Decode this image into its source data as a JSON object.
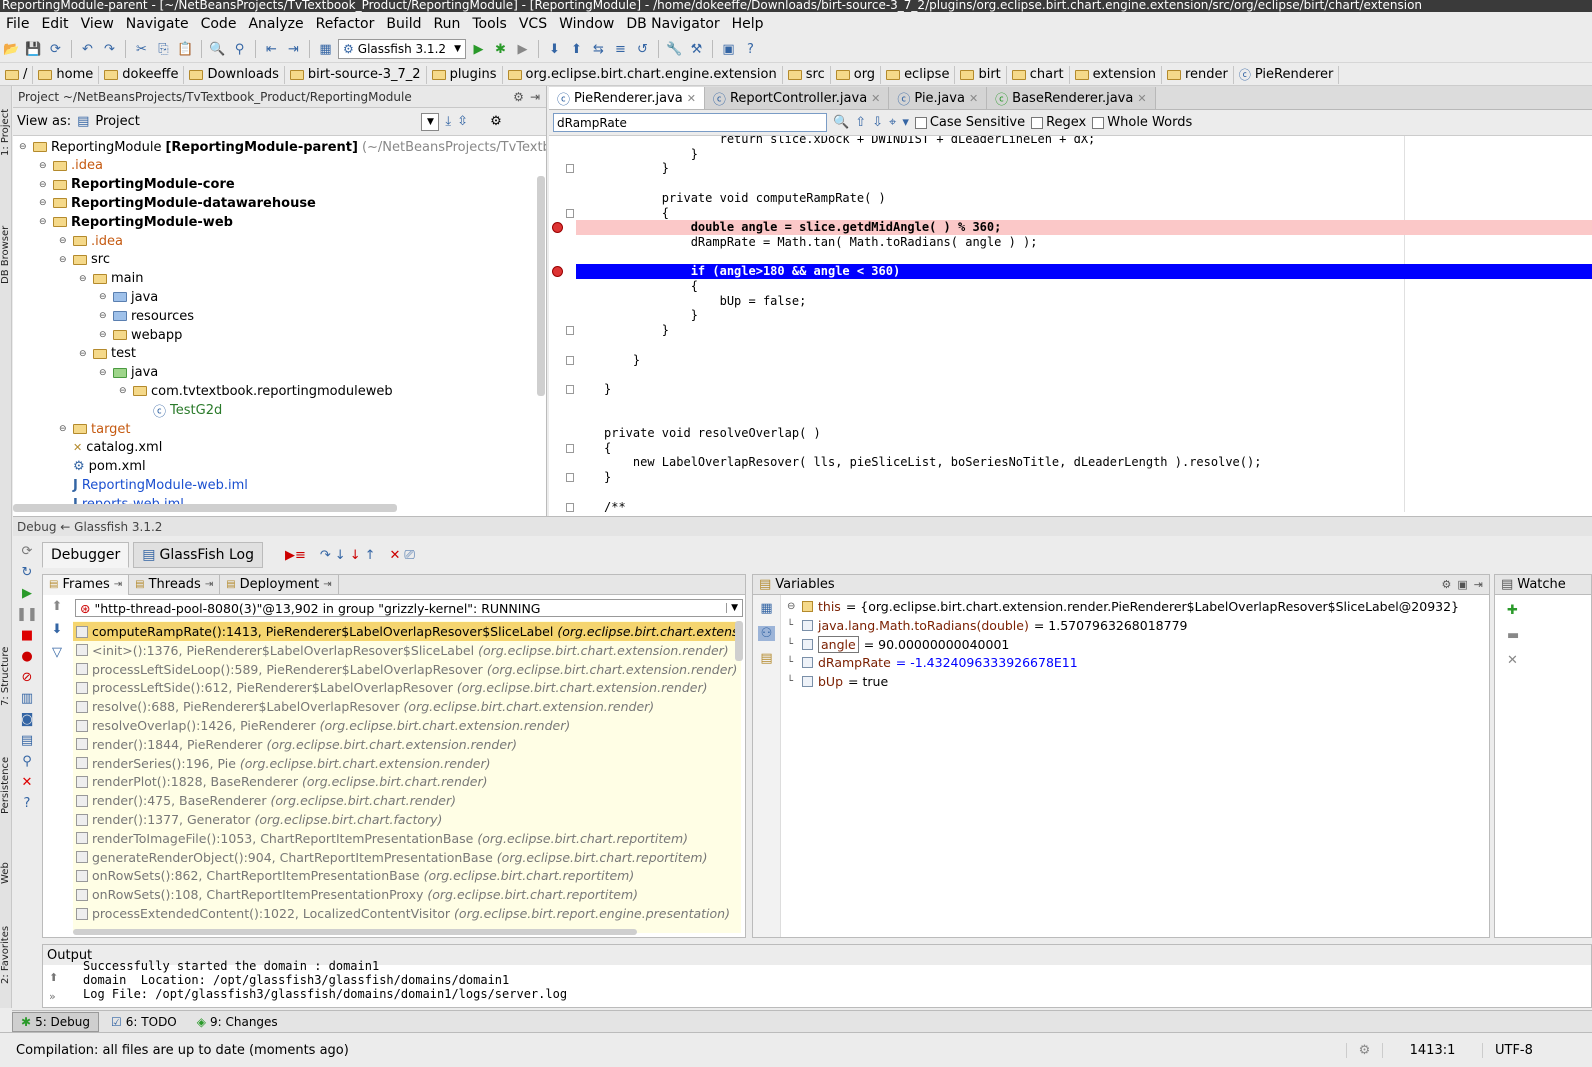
{
  "window": {
    "title": "ReportingModule-parent - [~/NetBeansProjects/TvTextbook_Product/ReportingModule] - [ReportingModule] - /home/dokeeffe/Downloads/birt-source-3_7_2/plugins/org.eclipse.birt.chart.engine.extension/src/org/eclipse/birt/chart/extension"
  },
  "menu": [
    "File",
    "Edit",
    "View",
    "Navigate",
    "Code",
    "Analyze",
    "Refactor",
    "Build",
    "Run",
    "Tools",
    "VCS",
    "Window",
    "DB Navigator",
    "Help"
  ],
  "toolbar": {
    "run_config": "Glassfish 3.1.2"
  },
  "breadcrumbs": [
    "/",
    "home",
    "dokeeffe",
    "Downloads",
    "birt-source-3_7_2",
    "plugins",
    "org.eclipse.birt.chart.engine.extension",
    "src",
    "org",
    "eclipse",
    "birt",
    "chart",
    "extension",
    "render",
    "PieRenderer"
  ],
  "left_strip": {
    "project": "1: Project",
    "db_browser": "DB Browser",
    "structure": "7: Structure",
    "persistence": "Persistence",
    "web": "Web",
    "favorites": "2: Favorites"
  },
  "project": {
    "header": "Project  ~/NetBeansProjects/TvTextbook_Product/ReportingModule",
    "view_as_label": "View as:",
    "view_as_value": "Project",
    "tree": [
      {
        "label": "ReportingModule",
        "bold_suffix": "[ReportingModule-parent]",
        "hint": "(~/NetBeansProjects/TvTextbook",
        "indent": 0,
        "icon": "folder",
        "style": "normal"
      },
      {
        "label": ".idea",
        "indent": 1,
        "icon": "folder",
        "style": "orange"
      },
      {
        "label": "ReportingModule-core",
        "indent": 1,
        "icon": "folder",
        "style": "bold"
      },
      {
        "label": "ReportingModule-datawarehouse",
        "indent": 1,
        "icon": "folder",
        "style": "bold"
      },
      {
        "label": "ReportingModule-web",
        "indent": 1,
        "icon": "folder",
        "style": "bold"
      },
      {
        "label": ".idea",
        "indent": 2,
        "icon": "folder",
        "style": "orange"
      },
      {
        "label": "src",
        "indent": 2,
        "icon": "folder",
        "style": "normal"
      },
      {
        "label": "main",
        "indent": 3,
        "icon": "folder",
        "style": "normal"
      },
      {
        "label": "java",
        "indent": 4,
        "icon": "folderb",
        "style": "normal"
      },
      {
        "label": "resources",
        "indent": 4,
        "icon": "folderb",
        "style": "normal"
      },
      {
        "label": "webapp",
        "indent": 4,
        "icon": "folder",
        "style": "normal"
      },
      {
        "label": "test",
        "indent": 3,
        "icon": "folder",
        "style": "normal"
      },
      {
        "label": "java",
        "indent": 4,
        "icon": "folderg",
        "style": "normal"
      },
      {
        "label": "com.tvtextbook.reportingmoduleweb",
        "indent": 5,
        "icon": "folder",
        "style": "normal"
      },
      {
        "label": "TestG2d",
        "indent": 6,
        "icon": "class",
        "style": "green"
      },
      {
        "label": "target",
        "indent": 2,
        "icon": "folder",
        "style": "orange"
      },
      {
        "label": "catalog.xml",
        "indent": 2,
        "icon": "xml",
        "style": "normal"
      },
      {
        "label": "pom.xml",
        "indent": 2,
        "icon": "pom",
        "style": "normal"
      },
      {
        "label": "ReportingModule-web.iml",
        "indent": 2,
        "icon": "iml",
        "style": "blue"
      },
      {
        "label": "reports-web.iml",
        "indent": 2,
        "icon": "iml",
        "style": "blue"
      }
    ]
  },
  "editor": {
    "tabs": [
      "PieRenderer.java",
      "ReportController.java",
      "Pie.java",
      "BaseRenderer.java"
    ],
    "search": {
      "value": "dRampRate",
      "case_sensitive": "Case Sensitive",
      "regex": "Regex",
      "whole_words": "Whole Words"
    },
    "lines": [
      {
        "t": "                return slice.xDock + DWINDIST + dLeaderLineLen + dX;",
        "cls": "",
        "bp": false
      },
      {
        "t": "            }",
        "cls": "",
        "bp": false
      },
      {
        "t": "        }",
        "cls": "",
        "bp": false
      },
      {
        "t": "",
        "cls": "",
        "bp": false
      },
      {
        "t": "        private void computeRampRate( )",
        "cls": "",
        "bp": false
      },
      {
        "t": "        {",
        "cls": "",
        "bp": false
      },
      {
        "t": "            double angle = slice.getdMidAngle( ) % 360;",
        "cls": "bp",
        "bp": true
      },
      {
        "t": "            dRampRate = Math.tan( Math.toRadians( angle ) );",
        "cls": "",
        "bp": false
      },
      {
        "t": "",
        "cls": "",
        "bp": false
      },
      {
        "t": "            if (angle>180 && angle < 360)",
        "cls": "cur",
        "bp": true
      },
      {
        "t": "            {",
        "cls": "",
        "bp": false
      },
      {
        "t": "                bUp = false;",
        "cls": "",
        "bp": false
      },
      {
        "t": "            }",
        "cls": "",
        "bp": false
      },
      {
        "t": "        }",
        "cls": "",
        "bp": false
      },
      {
        "t": "",
        "cls": "",
        "bp": false
      },
      {
        "t": "    }",
        "cls": "",
        "bp": false
      },
      {
        "t": "",
        "cls": "",
        "bp": false
      },
      {
        "t": "}",
        "cls": "",
        "bp": false
      },
      {
        "t": "",
        "cls": "",
        "bp": false
      },
      {
        "t": "",
        "cls": "",
        "bp": false
      },
      {
        "t": "private void resolveOverlap( )",
        "cls": "",
        "bp": false
      },
      {
        "t": "{",
        "cls": "",
        "bp": false
      },
      {
        "t": "    new LabelOverlapResover( lls, pieSliceList, boSeriesNoTitle, dLeaderLength ).resolve();",
        "cls": "",
        "bp": false
      },
      {
        "t": "}",
        "cls": "",
        "bp": false
      },
      {
        "t": "",
        "cls": "",
        "bp": false
      },
      {
        "t": "/**",
        "cls": "",
        "bp": false
      }
    ]
  },
  "debug": {
    "header": "Debug  ← Glassfish 3.1.2",
    "tabs": [
      "Debugger",
      "GlassFish Log"
    ],
    "subtabs": [
      "Frames",
      "Threads",
      "Deployment"
    ],
    "thread": "\"http-thread-pool-8080(3)\"@13,902 in group \"grizzly-kernel\": RUNNING",
    "frames": [
      {
        "m": "computeRampRate():1413, PieRenderer$LabelOverlapResover$SliceLabel",
        "p": "(org.eclipse.birt.chart.extension.render)"
      },
      {
        "m": "<init>():1376, PieRenderer$LabelOverlapResover$SliceLabel",
        "p": "(org.eclipse.birt.chart.extension.render)"
      },
      {
        "m": "processLeftSideLoop():589, PieRenderer$LabelOverlapResover",
        "p": "(org.eclipse.birt.chart.extension.render)"
      },
      {
        "m": "processLeftSide():612, PieRenderer$LabelOverlapResover",
        "p": "(org.eclipse.birt.chart.extension.render)"
      },
      {
        "m": "resolve():688, PieRenderer$LabelOverlapResover",
        "p": "(org.eclipse.birt.chart.extension.render)"
      },
      {
        "m": "resolveOverlap():1426, PieRenderer",
        "p": "(org.eclipse.birt.chart.extension.render)"
      },
      {
        "m": "render():1844, PieRenderer",
        "p": "(org.eclipse.birt.chart.extension.render)"
      },
      {
        "m": "renderSeries():196, Pie",
        "p": "(org.eclipse.birt.chart.extension.render)"
      },
      {
        "m": "renderPlot():1828, BaseRenderer",
        "p": "(org.eclipse.birt.chart.render)"
      },
      {
        "m": "render():475, BaseRenderer",
        "p": "(org.eclipse.birt.chart.render)"
      },
      {
        "m": "render():1377, Generator",
        "p": "(org.eclipse.birt.chart.factory)"
      },
      {
        "m": "renderToImageFile():1053, ChartReportItemPresentationBase",
        "p": "(org.eclipse.birt.chart.reportitem)"
      },
      {
        "m": "generateRenderObject():904, ChartReportItemPresentationBase",
        "p": "(org.eclipse.birt.chart.reportitem)"
      },
      {
        "m": "onRowSets():862, ChartReportItemPresentationBase",
        "p": "(org.eclipse.birt.chart.reportitem)"
      },
      {
        "m": "onRowSets():108, ChartReportItemPresentationProxy",
        "p": "(org.eclipse.birt.chart.reportitem)"
      },
      {
        "m": "processExtendedContent():1022, LocalizedContentVisitor",
        "p": "(org.eclipse.birt.report.engine.presentation)"
      }
    ],
    "variables_title": "Variables",
    "variables": [
      {
        "n": "this",
        "v": " = {org.eclipse.birt.chart.extension.render.PieRenderer$LabelOverlapResover$SliceLabel@20932}",
        "num": false,
        "expand": true
      },
      {
        "n": "java.lang.Math.toRadians(double)",
        "v": " = 1.5707963268018779",
        "num": false,
        "expand": false
      },
      {
        "n": "angle",
        "v": " = 90.00000000040001",
        "num": false,
        "expand": false
      },
      {
        "n": "dRampRate",
        "v": " = -1.4324096333926678E11",
        "num": true,
        "expand": false
      },
      {
        "n": "bUp",
        "v": " = true",
        "num": false,
        "expand": false
      }
    ],
    "watches_title": "Watche"
  },
  "output": {
    "title": "Output",
    "lines": [
      "Successfully started the domain : domain1",
      "domain  Location: /opt/glassfish3/glassfish/domains/domain1",
      "Log File: /opt/glassfish3/glassfish/domains/domain1/logs/server.log"
    ]
  },
  "bottom_tabs": [
    "5: Debug",
    "6: TODO",
    "9: Changes"
  ],
  "status": {
    "message": "Compilation: all files are up to date (moments ago)",
    "position": "1413:1",
    "encoding": "UTF-8"
  }
}
